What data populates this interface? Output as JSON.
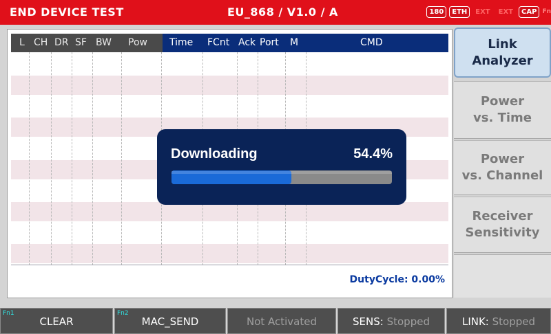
{
  "titlebar": {
    "title": "END DEVICE TEST",
    "mode": "EU_868 / V1.0 / A",
    "badges": [
      "180",
      "ETH",
      "EXT",
      "EXT",
      "CAP",
      "Fn"
    ]
  },
  "table": {
    "left_headers": [
      "L",
      "CH",
      "DR",
      "SF",
      "BW",
      "Pow"
    ],
    "right_headers": [
      "Time",
      "FCnt",
      "Ack",
      "Port",
      "M",
      "CMD"
    ]
  },
  "dialog": {
    "title": "Downloading",
    "percent_text": "54.4%",
    "progress": 0.544
  },
  "status": {
    "duty_cycle": "DutyCycle: 0.00%"
  },
  "sidebar": {
    "items": [
      {
        "label": "Link\nAnalyzer",
        "active": true
      },
      {
        "label": "Power\nvs. Time",
        "active": false
      },
      {
        "label": "Power\nvs. Channel",
        "active": false
      },
      {
        "label": "Receiver\nSensitivity",
        "active": false
      }
    ]
  },
  "footer": {
    "fn1_tag": "Fn1",
    "fn1_label": "CLEAR",
    "fn2_tag": "Fn2",
    "fn2_label": "MAC_SEND",
    "not_activated": "Not Activated",
    "sens_key": "SENS:",
    "sens_value": "Stopped",
    "link_key": "LINK:",
    "link_value": "Stopped"
  },
  "colors": {
    "titlebar": "#e0101a",
    "header_dark": "#4a4a4a",
    "header_blue": "#0a2d7a",
    "dialog": "#0a2357",
    "progress_fill": "#1a6ad8",
    "progress_track": "#8a8a8a",
    "fn_tag": "#30e0e0"
  }
}
